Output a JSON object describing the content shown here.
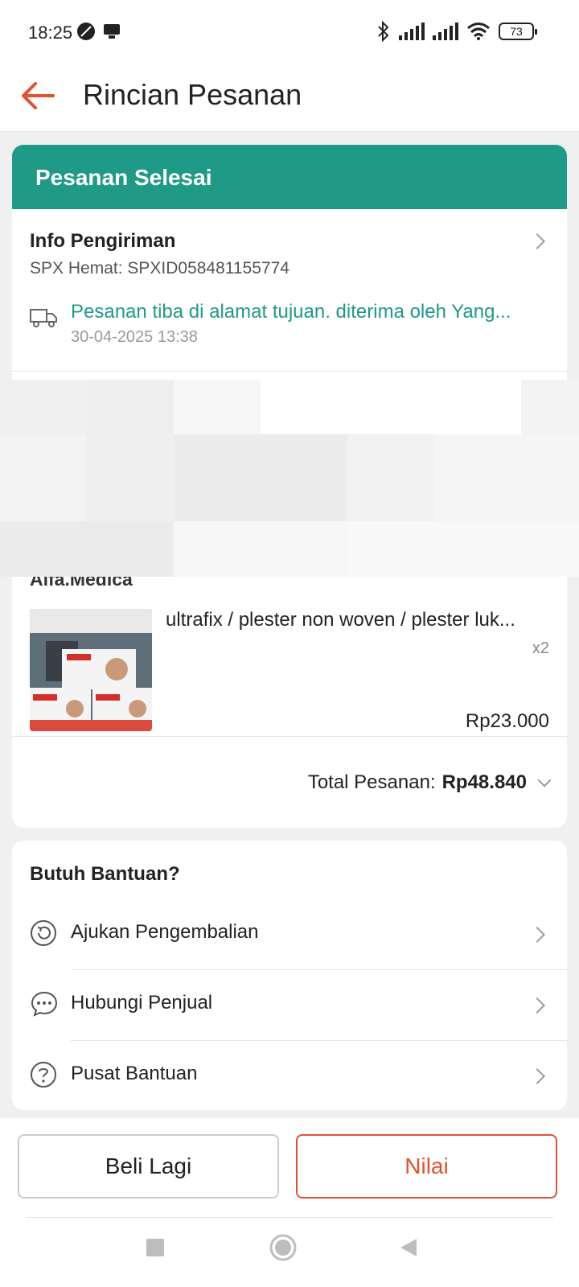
{
  "status_bar": {
    "time": "18:25",
    "battery": "73"
  },
  "header": {
    "title": "Rincian Pesanan"
  },
  "order_status": {
    "label": "Pesanan Selesai"
  },
  "shipping": {
    "title": "Info Pengiriman",
    "tracking": "SPX Hemat: SPXID058481155774",
    "latest_status": "Pesanan tiba di alamat tujuan. diterima oleh Yang...",
    "timestamp": "30-04-2025 13:38"
  },
  "product": {
    "shop_name": "Alfa.Medica",
    "name": "ultrafix / plester non woven / plester luk...",
    "quantity": "x2",
    "price": "Rp23.000"
  },
  "total": {
    "label": "Total Pesanan:",
    "value": "Rp48.840"
  },
  "help": {
    "title": "Butuh Bantuan?",
    "items": [
      {
        "label": "Ajukan Pengembalian",
        "icon": "return-icon"
      },
      {
        "label": "Hubungi Penjual",
        "icon": "chat-icon"
      },
      {
        "label": "Pusat Bantuan",
        "icon": "help-icon"
      }
    ]
  },
  "actions": {
    "rebuy_label": "Beli Lagi",
    "rate_label": "Nilai"
  },
  "colors": {
    "accent": "#e4502e",
    "status_green": "#1f9a86"
  }
}
